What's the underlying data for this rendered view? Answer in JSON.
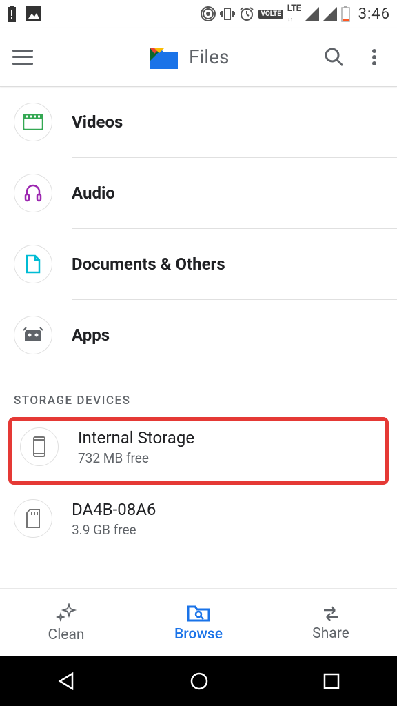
{
  "status_bar": {
    "time": "3:46"
  },
  "app_bar": {
    "title": "Files"
  },
  "categories": [
    {
      "label": "Videos",
      "icon": "video-icon"
    },
    {
      "label": "Audio",
      "icon": "audio-icon"
    },
    {
      "label": "Documents & Others",
      "icon": "document-icon"
    },
    {
      "label": "Apps",
      "icon": "apps-icon"
    }
  ],
  "section": {
    "title": "STORAGE DEVICES"
  },
  "storage": [
    {
      "name": "Internal Storage",
      "sub": "732 MB free",
      "icon": "phone-icon",
      "highlighted": true
    },
    {
      "name": "DA4B-08A6",
      "sub": "3.9 GB free",
      "icon": "sd-card-icon",
      "highlighted": false
    }
  ],
  "bottom_nav": [
    {
      "label": "Clean",
      "icon": "sparkle-icon",
      "active": false
    },
    {
      "label": "Browse",
      "icon": "folder-search-icon",
      "active": true
    },
    {
      "label": "Share",
      "icon": "swap-icon",
      "active": false
    }
  ]
}
